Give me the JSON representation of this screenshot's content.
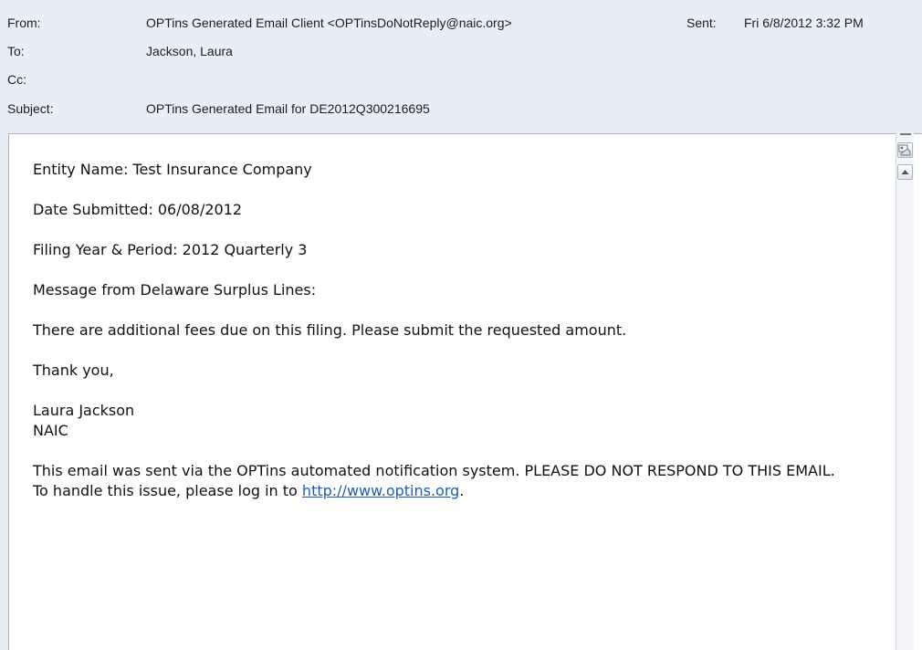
{
  "header": {
    "from_label": "From:",
    "from_value": "OPTins Generated Email Client <OPTinsDoNotReply@naic.org>",
    "sent_label": "Sent:",
    "sent_value": "Fri 6/8/2012 3:32 PM",
    "to_label": "To:",
    "to_value": "Jackson, Laura",
    "cc_label": "Cc:",
    "cc_value": "",
    "subject_label": "Subject:",
    "subject_value": "OPTins Generated Email for DE2012Q300216695"
  },
  "body": {
    "entity": "Entity Name: Test Insurance Company",
    "date_submitted": "Date Submitted: 06/08/2012",
    "filing": "Filing Year & Period: 2012 Quarterly 3",
    "message_from": "Message from Delaware Surplus Lines:",
    "message": "There are additional fees due on this filing. Please submit the requested amount.",
    "thanks": "Thank you,",
    "sig_name": "Laura Jackson",
    "sig_org": "NAIC",
    "footer_text": "This email was sent via the OPTins automated notification system. PLEASE DO NOT RESPOND TO THIS EMAIL. To handle this issue, please log in to",
    "footer_link": "http://www.optins.org",
    "footer_end": "."
  },
  "icons": {
    "people_pane": "people-pane-icon",
    "scroll_up": "arrow-up-icon"
  },
  "colors": {
    "header_bg": "#e8eef6",
    "link": "#1a5fb4",
    "border": "#a7b1bd"
  }
}
